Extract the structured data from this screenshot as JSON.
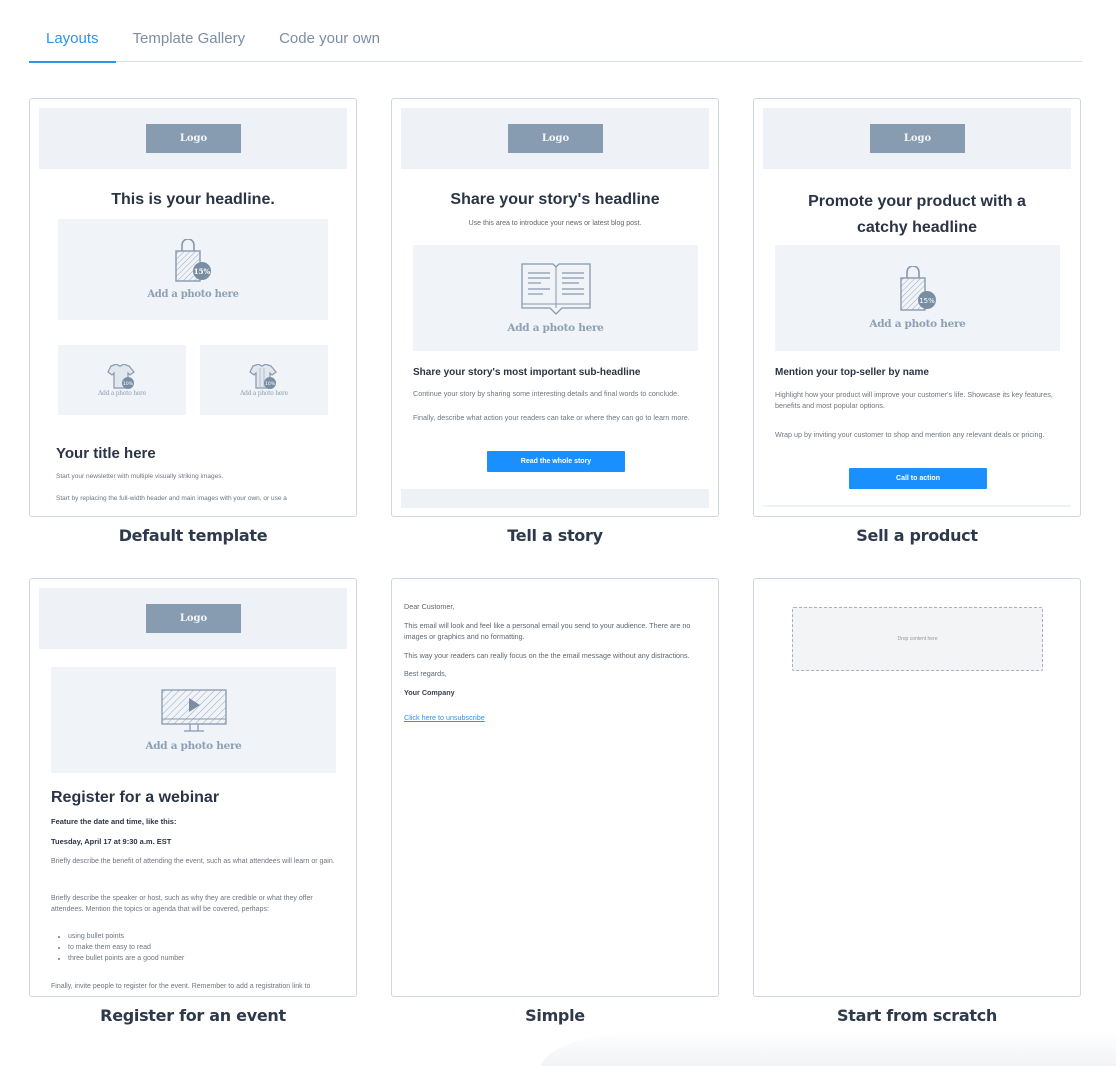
{
  "tabs": [
    {
      "label": "Layouts",
      "active": true
    },
    {
      "label": "Template Gallery",
      "active": false
    },
    {
      "label": "Code your own",
      "active": false
    }
  ],
  "colors": {
    "accent": "#2f93f0",
    "button": "#1a90ff",
    "logo_fill": "#879cb0",
    "placeholder_bg": "#eef1f5",
    "heading_text": "#2e3a4b"
  },
  "templates": [
    {
      "title": "Default template",
      "logo": "Logo",
      "headline": "This is your headline.",
      "photo_label": "Add a photo here",
      "photo_icon": "shopping-bag-discount-icon",
      "discount_badge": "15%",
      "small_photos": [
        {
          "label": "Add a photo here",
          "icon": "tshirt-icon",
          "badge": "10%"
        },
        {
          "label": "Add a photo here",
          "icon": "tshirt-icon",
          "badge": "10%"
        }
      ],
      "section_title": "Your title here",
      "paragraphs": [
        "Start your newsletter with multiple visually striking images.",
        "Start by replacing the full-width header and main images with your own, or use a"
      ]
    },
    {
      "title": "Tell a story",
      "logo": "Logo",
      "headline": "Share your story's headline",
      "intro": "Use this area to introduce your news or latest blog post.",
      "photo_label": "Add a photo here",
      "photo_icon": "open-book-icon",
      "sub_headline": "Share your story's most important sub-headline",
      "paragraphs": [
        "Continue your story by sharing some interesting details and final words to conclude.",
        "Finally, describe what action your readers can take or where they can go to learn more."
      ],
      "button": "Read the whole story"
    },
    {
      "title": "Sell a product",
      "logo": "Logo",
      "headline": "Promote your product with a catchy headline",
      "photo_label": "Add a photo here",
      "photo_icon": "shopping-bag-discount-icon",
      "discount_badge": "15%",
      "sub_headline": "Mention your top-seller by name",
      "paragraphs": [
        "Highlight how your product will improve your customer's life. Showcase its key features, benefits and most popular options.",
        "Wrap up by inviting your customer to shop and mention any relevant deals or pricing."
      ],
      "button": "Call to action"
    },
    {
      "title": "Register for an event",
      "logo": "Logo",
      "photo_label": "Add a photo here",
      "photo_icon": "monitor-play-icon",
      "headline": "Register for a webinar",
      "feature_line": "Feature the date and time, like this:",
      "date_line": "Tuesday, April 17 at 9:30 a.m. EST",
      "paragraphs": [
        "Briefly describe the benefit of attending the event, such as what attendees will learn or gain.",
        "Briefly describe the speaker or host, such as why they are credible or what they offer attendees. Mention the topics or agenda that will be covered, perhaps:"
      ],
      "bullets": [
        "using bullet points",
        "to make them easy to read",
        "three bullet points are a good number"
      ],
      "closing": "Finally, invite people to register for the event. Remember to add a registration link to"
    },
    {
      "title": "Simple",
      "greeting": "Dear Customer,",
      "paragraphs": [
        "This email will look and feel like a personal email you send to your audience. There are no images or graphics and no formatting.",
        "This way your readers can really focus on the the email message without any distractions."
      ],
      "signoff": "Best regards,",
      "company": "Your Company",
      "unsubscribe": "Click here to unsubscribe"
    },
    {
      "title": "Start from scratch",
      "drop_label": "Drop content here"
    }
  ]
}
